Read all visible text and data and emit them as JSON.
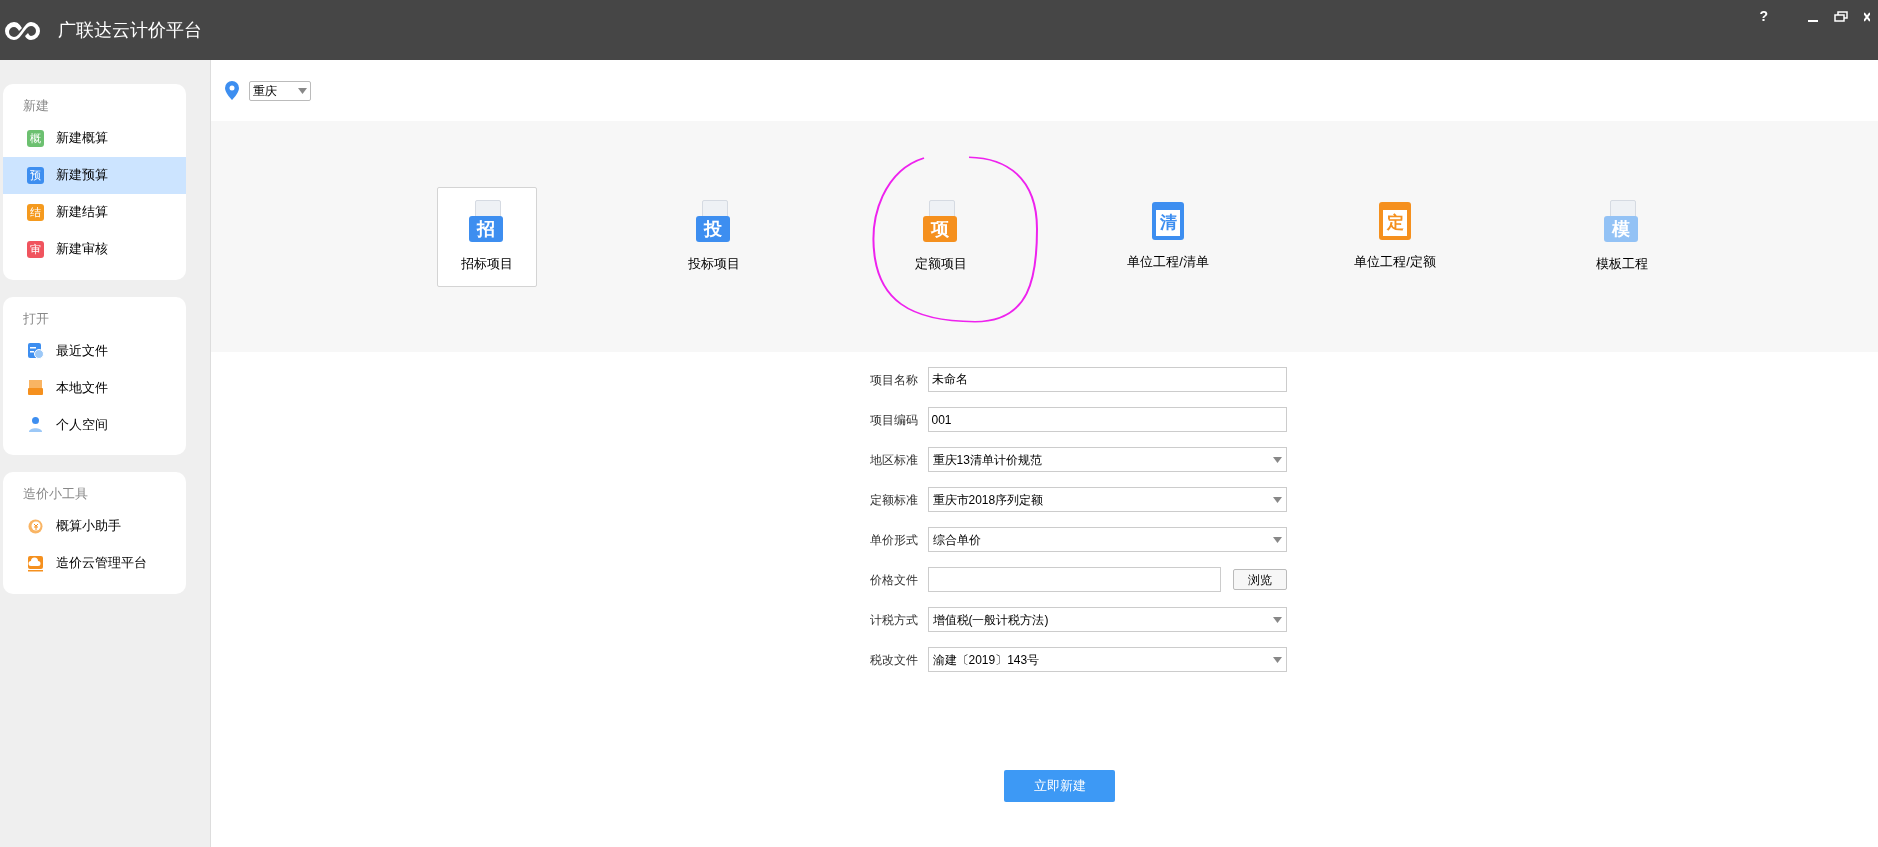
{
  "window": {
    "title": "广联达云计价平台",
    "help": "?"
  },
  "location": {
    "value": "重庆"
  },
  "sidebar": [
    {
      "title": "新建",
      "items": [
        {
          "kind": "badge",
          "glyph": "概",
          "color": "#6cc070",
          "label": "新建概算",
          "selected": false
        },
        {
          "kind": "badge",
          "glyph": "预",
          "color": "#3d8ef0",
          "label": "新建预算",
          "selected": true
        },
        {
          "kind": "badge",
          "glyph": "结",
          "color": "#f59a1e",
          "label": "新建结算",
          "selected": false
        },
        {
          "kind": "badge",
          "glyph": "审",
          "color": "#f0545e",
          "label": "新建审核",
          "selected": false
        }
      ]
    },
    {
      "title": "打开",
      "items": [
        {
          "kind": "recent",
          "label": "最近文件",
          "selected": false
        },
        {
          "kind": "local",
          "label": "本地文件",
          "selected": false
        },
        {
          "kind": "person",
          "label": "个人空间",
          "selected": false
        }
      ]
    },
    {
      "title": "造价小工具",
      "items": [
        {
          "kind": "coin",
          "label": "概算小助手",
          "selected": false
        },
        {
          "kind": "cloud",
          "label": "造价云管理平台",
          "selected": false
        }
      ]
    }
  ],
  "project_types": [
    {
      "kind": "doc",
      "glyph": "招",
      "color": "#3d8ef0",
      "label": "招标项目",
      "selected": true
    },
    {
      "kind": "doc",
      "glyph": "投",
      "color": "#3d8ef0",
      "label": "投标项目",
      "selected": false
    },
    {
      "kind": "doc",
      "glyph": "项",
      "color": "#f5901e",
      "label": "定额项目",
      "selected": false
    },
    {
      "kind": "notebook",
      "glyph": "清",
      "color": "#3d8ef0",
      "label": "单位工程/清单",
      "selected": false
    },
    {
      "kind": "notebook",
      "glyph": "定",
      "color": "#f5901e",
      "label": "单位工程/定额",
      "selected": false
    },
    {
      "kind": "doc",
      "glyph": "模",
      "color": "#93c2f5",
      "label": "模板工程",
      "selected": false
    }
  ],
  "form": [
    {
      "kind": "text",
      "label": "项目名称",
      "value": "未命名"
    },
    {
      "kind": "text",
      "label": "项目编码",
      "value": "001"
    },
    {
      "kind": "select",
      "label": "地区标准",
      "value": "重庆13清单计价规范"
    },
    {
      "kind": "select",
      "label": "定额标准",
      "value": "重庆市2018序列定额"
    },
    {
      "kind": "select",
      "label": "单价形式",
      "value": "综合单价"
    },
    {
      "kind": "file",
      "label": "价格文件",
      "button": "浏览"
    },
    {
      "kind": "select",
      "label": "计税方式",
      "value": "增值税(一般计税方法)"
    },
    {
      "kind": "select",
      "label": "税改文件",
      "value": "渝建〔2019〕143号"
    }
  ],
  "submit": "立即新建"
}
